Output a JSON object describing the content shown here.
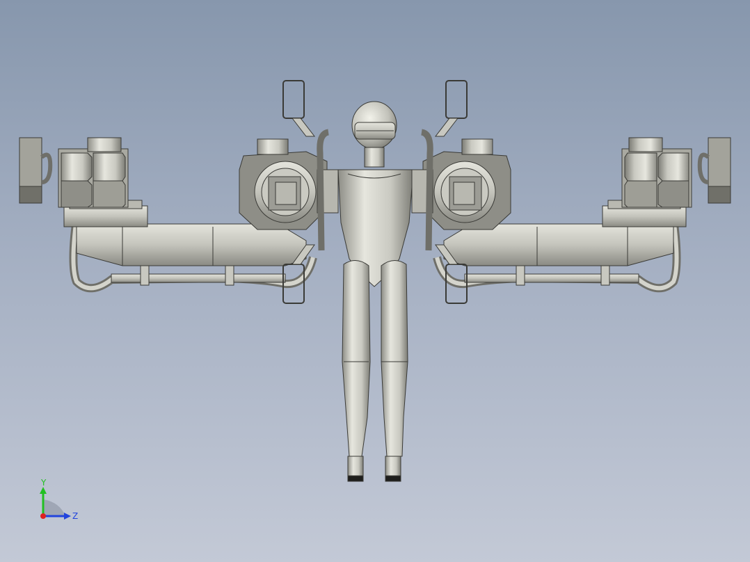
{
  "viewport": {
    "background_top": "#8797ad",
    "background_bottom": "#c3c9d6"
  },
  "model": {
    "icon": "mechanical-jetpack-mannequin-assembly",
    "part_color": "#c8c8c0",
    "edge_color": "#3a3a36"
  },
  "triad": {
    "y_label": "Y",
    "z_label": "Z",
    "y_color": "#22c022",
    "z_color": "#2244dd",
    "x_color": "#dd2222"
  }
}
